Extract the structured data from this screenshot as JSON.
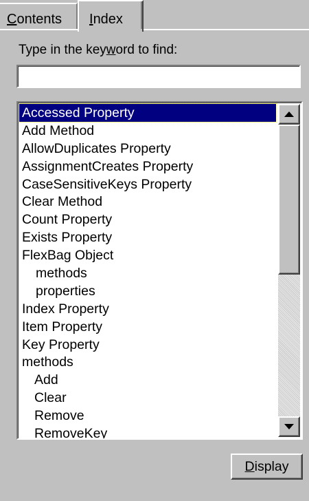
{
  "tabs": {
    "contents": {
      "pre": "",
      "accel": "C",
      "post": "ontents"
    },
    "index": {
      "pre": "",
      "accel": "I",
      "post": "ndex"
    }
  },
  "prompt": {
    "pre": "Type in the key",
    "accel": "w",
    "post": "ord to find:"
  },
  "keyword_input": {
    "value": "",
    "placeholder": ""
  },
  "list": {
    "items": [
      {
        "label": "Accessed Property",
        "indent": 0,
        "selected": true
      },
      {
        "label": "Add Method",
        "indent": 0
      },
      {
        "label": "AllowDuplicates Property",
        "indent": 0
      },
      {
        "label": "AssignmentCreates Property",
        "indent": 0
      },
      {
        "label": "CaseSensitiveKeys Property",
        "indent": 0
      },
      {
        "label": "Clear Method",
        "indent": 0
      },
      {
        "label": "Count Property",
        "indent": 0
      },
      {
        "label": "Exists Property",
        "indent": 0
      },
      {
        "label": "FlexBag Object",
        "indent": 0
      },
      {
        "label": "methods",
        "indent": 2
      },
      {
        "label": "properties",
        "indent": 2
      },
      {
        "label": "Index Property",
        "indent": 0
      },
      {
        "label": "Item Property",
        "indent": 0
      },
      {
        "label": "Key Property",
        "indent": 0
      },
      {
        "label": "methods",
        "indent": 0
      },
      {
        "label": "Add",
        "indent": 1
      },
      {
        "label": "Clear",
        "indent": 1
      },
      {
        "label": "Remove",
        "indent": 1
      },
      {
        "label": "RemoveKey",
        "indent": 1
      }
    ]
  },
  "scrollbar": {
    "up_icon": "scroll-up-arrow-icon",
    "down_icon": "scroll-down-arrow-icon",
    "position": 0.0
  },
  "display_button": {
    "pre": "",
    "accel": "D",
    "post": "isplay"
  },
  "colors": {
    "face": "#c0c0c0",
    "selection": "#000080",
    "selection_text": "#ffffff"
  }
}
